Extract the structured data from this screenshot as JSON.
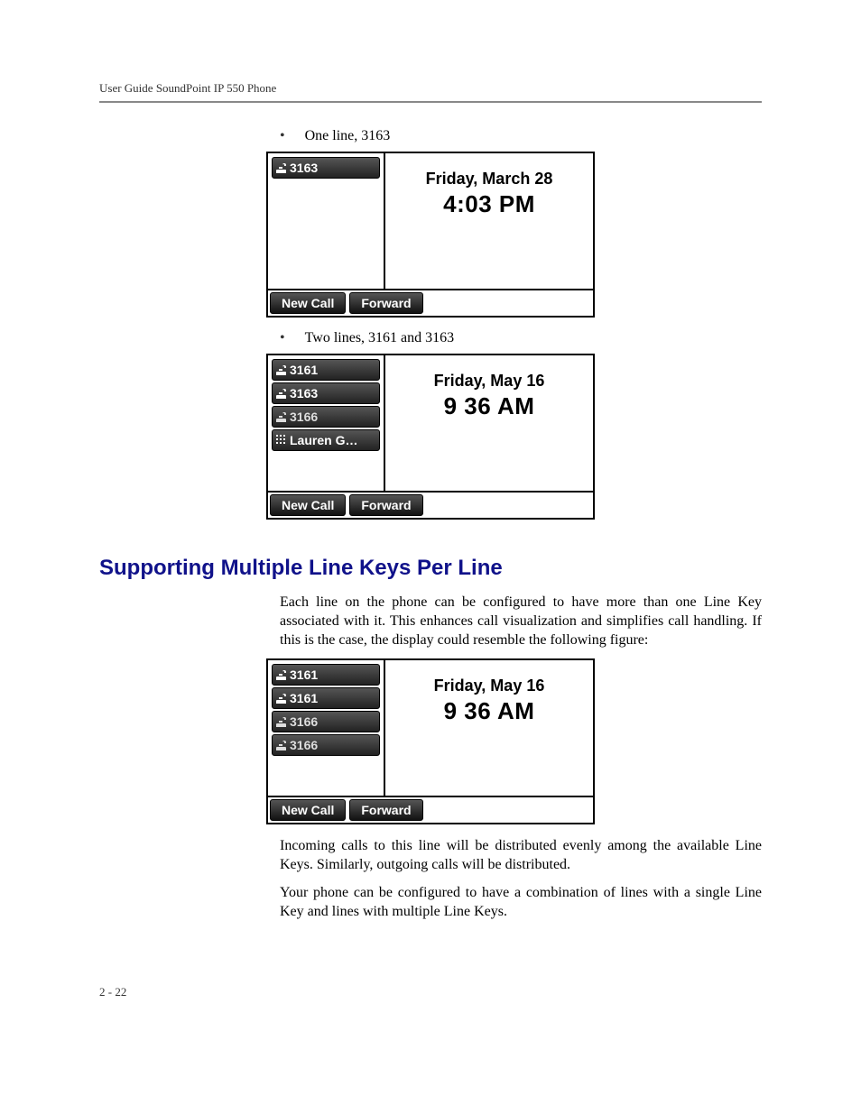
{
  "header": "User Guide SoundPoint IP 550 Phone",
  "bullets": {
    "b1": "One line, 3163",
    "b2": "Two lines, 3161 and 3163"
  },
  "screens": {
    "s1": {
      "lines": [
        {
          "icon": "phone",
          "label": "3163",
          "style": "active"
        }
      ],
      "date": "Friday, March 28",
      "time": "4:03 PM",
      "softkeys": [
        "New Call",
        "Forward"
      ]
    },
    "s2": {
      "lines": [
        {
          "icon": "phone",
          "label": "3161",
          "style": "active"
        },
        {
          "icon": "phone",
          "label": "3163",
          "style": "active"
        },
        {
          "icon": "phone",
          "label": "3166",
          "style": "shared"
        },
        {
          "icon": "dots",
          "label": "Lauren G…",
          "style": "active"
        }
      ],
      "date": "Friday, May 16",
      "time": "9 36 AM",
      "softkeys": [
        "New Call",
        "Forward"
      ]
    },
    "s3": {
      "lines": [
        {
          "icon": "phone",
          "label": "3161",
          "style": "active"
        },
        {
          "icon": "phone",
          "label": "3161",
          "style": "active"
        },
        {
          "icon": "phone",
          "label": "3166",
          "style": "shared"
        },
        {
          "icon": "phone",
          "label": "3166",
          "style": "shared"
        }
      ],
      "date": "Friday, May 16",
      "time": "9 36 AM",
      "softkeys": [
        "New Call",
        "Forward"
      ]
    }
  },
  "section_heading": "Supporting Multiple Line Keys Per Line",
  "paragraphs": {
    "p1": "Each line on the phone can be configured to have more than one Line Key associated with it. This enhances call visualization and simplifies call handling. If this is the case, the display could resemble the following figure:",
    "p2": "Incoming calls to this line will be distributed evenly among the available Line Keys. Similarly, outgoing calls will be distributed.",
    "p3": "Your phone can be configured to have a combination of lines with a single Line Key and lines with multiple Line Keys."
  },
  "page_number": "2 - 22"
}
